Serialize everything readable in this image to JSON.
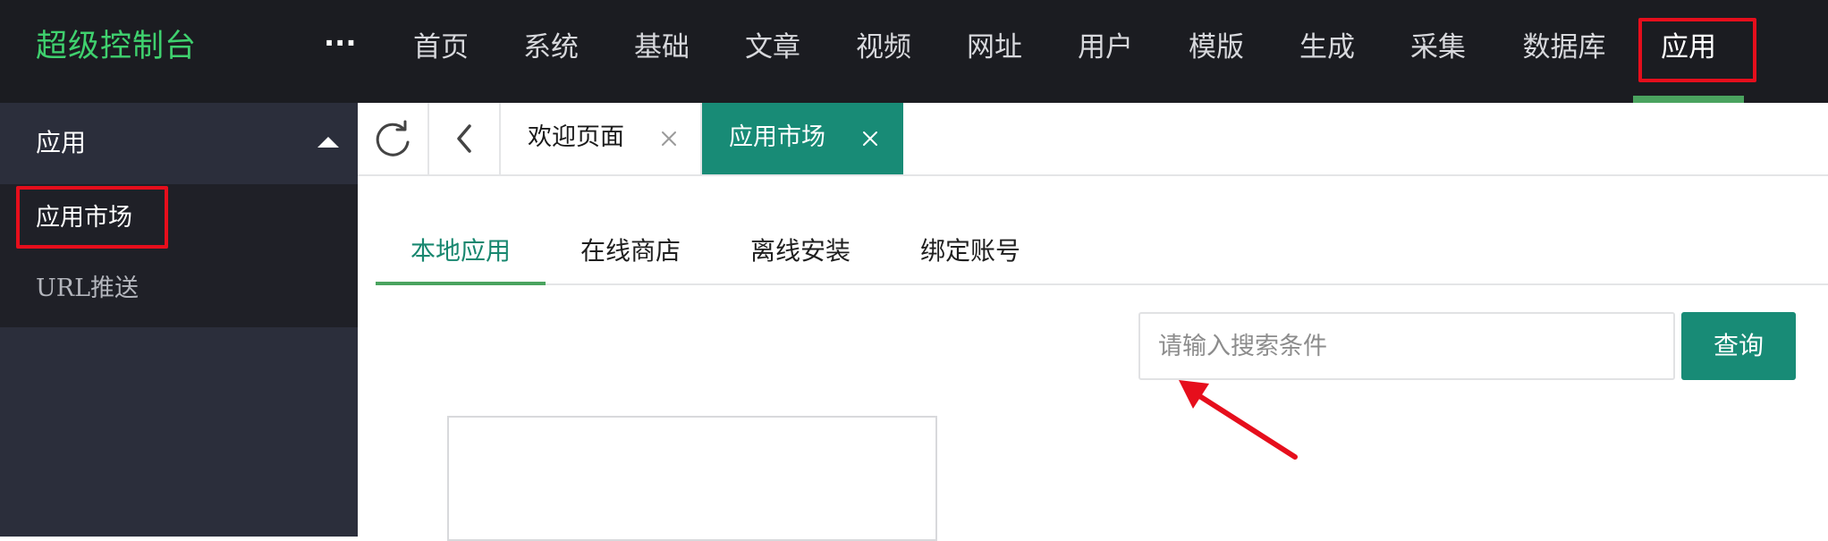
{
  "header": {
    "logo": "超级控制台",
    "more_label": "···",
    "nav": [
      {
        "label": "首页"
      },
      {
        "label": "系统"
      },
      {
        "label": "基础"
      },
      {
        "label": "文章"
      },
      {
        "label": "视频"
      },
      {
        "label": "网址"
      },
      {
        "label": "用户"
      },
      {
        "label": "模版"
      },
      {
        "label": "生成"
      },
      {
        "label": "采集"
      },
      {
        "label": "数据库"
      },
      {
        "label": "应用"
      }
    ],
    "active_nav": "应用"
  },
  "sidebar": {
    "group_label": "应用",
    "items": [
      {
        "label": "应用市场"
      },
      {
        "label": "URL推送"
      }
    ]
  },
  "tabs": {
    "refresh_icon": "refresh-icon",
    "back_icon": "chevron-left-icon",
    "pages": [
      {
        "label": "欢迎页面"
      },
      {
        "label": "应用市场"
      }
    ]
  },
  "market": {
    "subtabs": [
      {
        "label": "本地应用"
      },
      {
        "label": "在线商店"
      },
      {
        "label": "离线安装"
      },
      {
        "label": "绑定账号"
      }
    ],
    "search": {
      "placeholder": "请输入搜索条件",
      "value": ""
    },
    "query_label": "查询"
  },
  "colors": {
    "header_bg": "#1b1c21",
    "logo": "#3fd16e",
    "accent": "#188b76",
    "underline": "#4aa35f",
    "highlight": "#e60e1c",
    "sidebar_bg": "#2b2e3b"
  }
}
